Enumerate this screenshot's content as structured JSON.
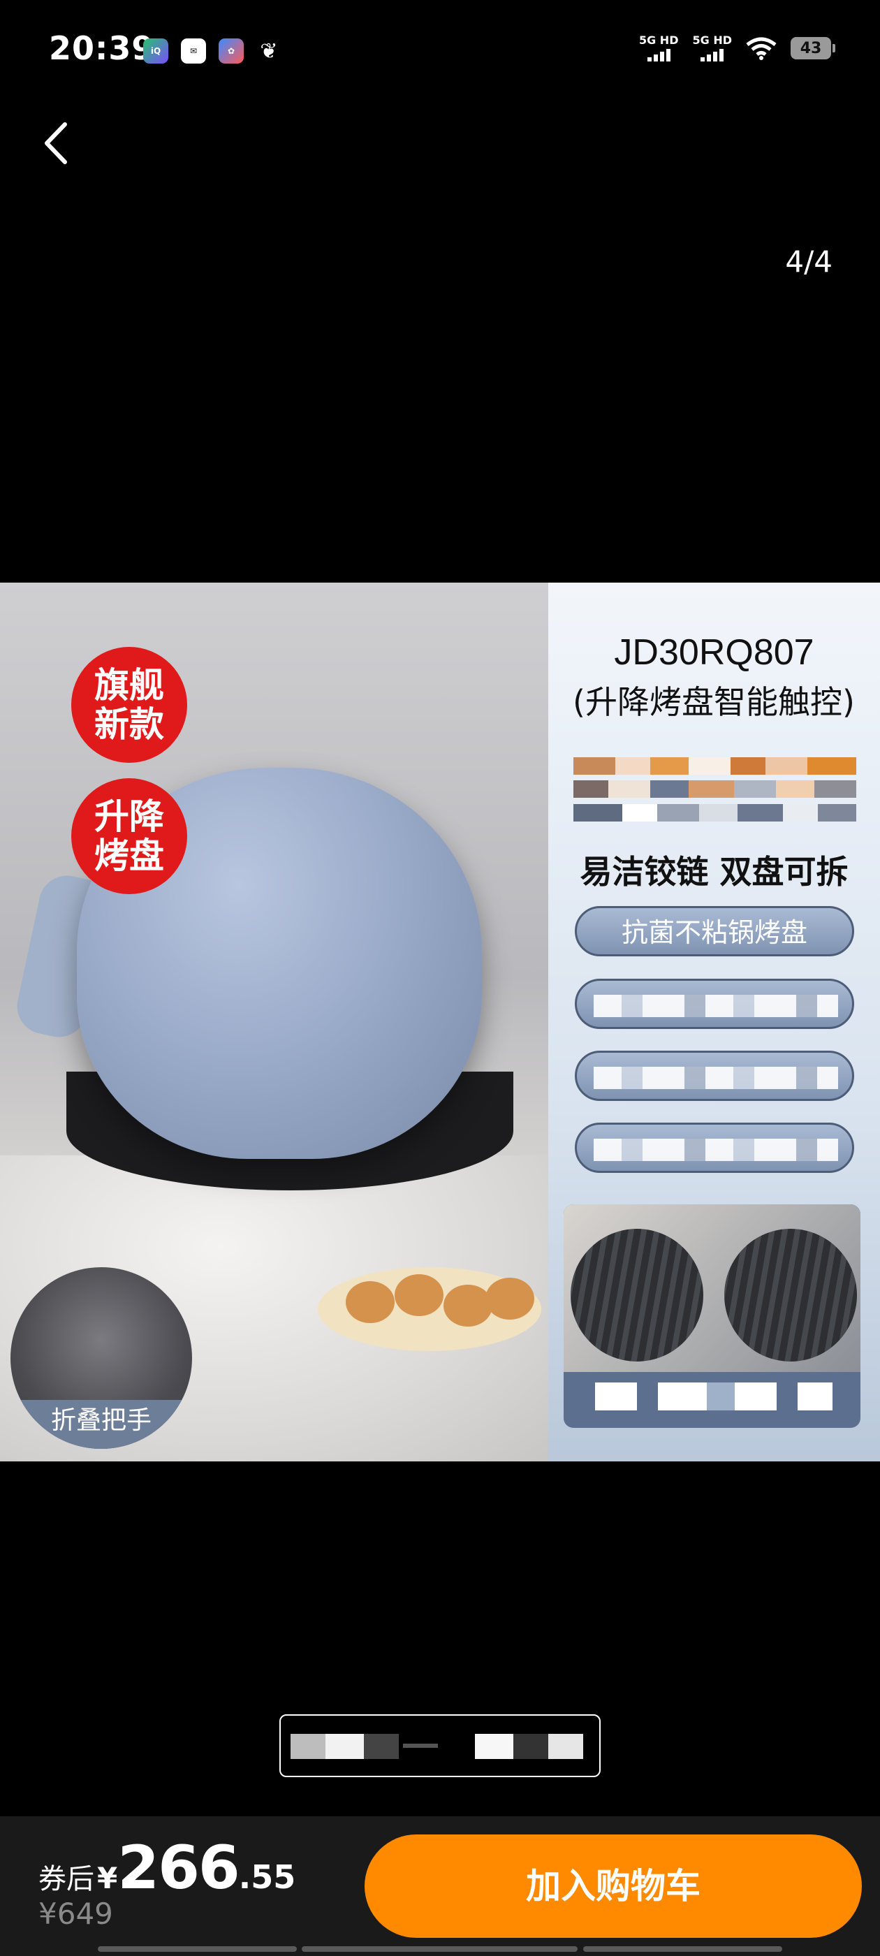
{
  "status_bar": {
    "time": "20:39",
    "network_1": "5G HD",
    "network_2": "5G HD",
    "battery": "43"
  },
  "gallery": {
    "counter": "4/4"
  },
  "product_image": {
    "badge_1": [
      "旗舰",
      "新款"
    ],
    "badge_2": [
      "升降",
      "烤盘"
    ],
    "fold_label": "折叠把手",
    "model": "JD30RQ807",
    "subtitle": "(升降烤盘智能触控)",
    "feature": "易洁铰链 双盘可拆",
    "pill_1": "抗菌不粘锅烤盘"
  },
  "bottom_bar": {
    "price_prefix": "券后",
    "currency": "¥",
    "price_integer": "266",
    "price_decimal": ".55",
    "original_price": "¥649",
    "cart_button": "加入购物车"
  },
  "colors": {
    "accent": "#ff8a00",
    "badge_red": "#e01a1a",
    "bar_bg": "#1a1a1a"
  }
}
